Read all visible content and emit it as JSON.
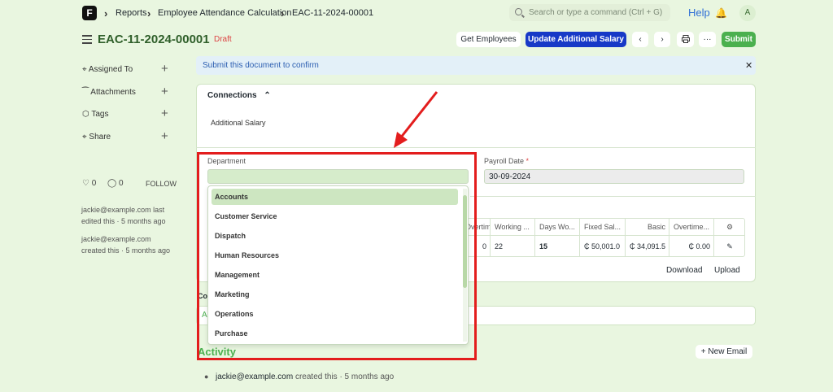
{
  "breadcrumbs": [
    "Reports",
    "Employee Attendance Calculation",
    "EAC-11-2024-00001"
  ],
  "search": {
    "placeholder": "Search or type a command (Ctrl + G)"
  },
  "nav": {
    "help": "Help",
    "avatar": "A",
    "logo": "F"
  },
  "doc": {
    "title": "EAC-11-2024-00001",
    "status": "Draft"
  },
  "toolbar": {
    "get_employees": "Get Employees",
    "update_salary": "Update Additional Salary",
    "more": "···",
    "submit": "Submit"
  },
  "sidebar": {
    "items": [
      {
        "label": "Assigned To",
        "icon": "assign-icon"
      },
      {
        "label": "Attachments",
        "icon": "paperclip-icon"
      },
      {
        "label": "Tags",
        "icon": "tag-icon"
      },
      {
        "label": "Share",
        "icon": "share-icon"
      }
    ],
    "likes": "0",
    "comments": "0",
    "follow": "FOLLOW",
    "activity": [
      {
        "line1": "jackie@example.com last",
        "line2": "edited this · 5 months ago"
      },
      {
        "line1": "jackie@example.com",
        "line2": "created this · 5 months ago"
      }
    ]
  },
  "banner": {
    "text": "Submit this document to confirm"
  },
  "connections": {
    "title": "Connections",
    "item": "Additional Salary"
  },
  "form": {
    "department_label": "Department",
    "department_value": "",
    "payroll_label": "Payroll Date",
    "payroll_required": "*",
    "payroll_value": "30-09-2024"
  },
  "dropdown": {
    "options": [
      "Accounts",
      "Customer Service",
      "Dispatch",
      "Human Resources",
      "Management",
      "Marketing",
      "Operations",
      "Purchase"
    ],
    "selected": "Accounts"
  },
  "table": {
    "headers": [
      "Overtime...",
      "Working ...",
      "Days Wo...",
      "Fixed Sal...",
      "Basic",
      "Overtime..."
    ],
    "row": [
      "0",
      "22",
      "15",
      "₵ 50,001.0",
      "₵ 34,091.5",
      "₵ 0.00"
    ],
    "download": "Download",
    "upload": "Upload"
  },
  "lower": {
    "comment_stub": "Co",
    "add_stub": "A"
  },
  "activity": {
    "title": "Activity",
    "new_email": "+ New Email",
    "entry_user": "jackie@example.com",
    "entry_text": "created this · 5 months ago"
  },
  "colors": {
    "brand": "#1739c7",
    "submit": "#4bb04f",
    "highlight": "#e31d1d",
    "background": "#e9f6e0"
  }
}
